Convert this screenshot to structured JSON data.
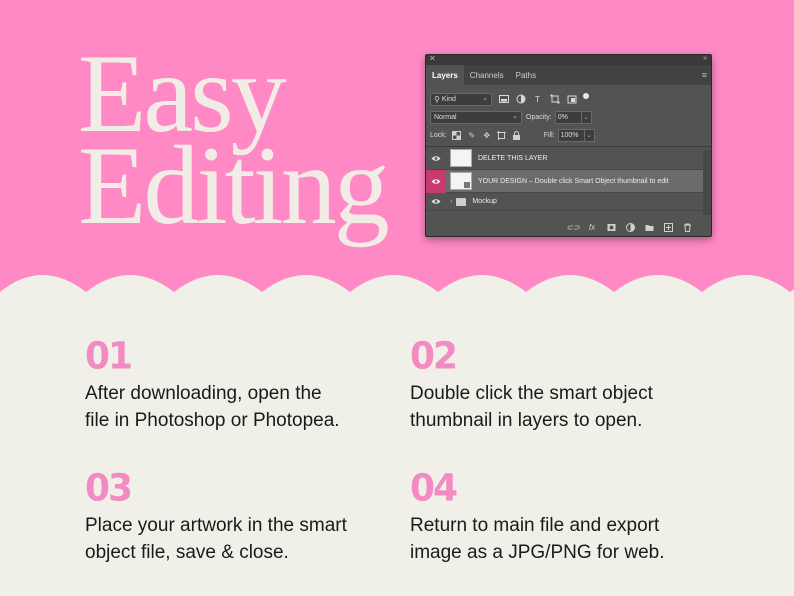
{
  "colors": {
    "hero_background": "#FF89C4",
    "cream_background": "#F1F0E8",
    "headline_text": "#F3ECE6",
    "step_number": "#F38BC3",
    "panel_background": "#535353",
    "layer_eye_highlight": "#C7396F"
  },
  "headline": {
    "line1": "Easy",
    "line2": "Editing"
  },
  "panel": {
    "tabs": [
      {
        "label": "Layers",
        "active": true
      },
      {
        "label": "Channels",
        "active": false
      },
      {
        "label": "Paths",
        "active": false
      }
    ],
    "filter_kind": "Kind",
    "filter_icons": [
      "image-filter-icon",
      "adjustment-filter-icon",
      "type-filter-icon",
      "shape-filter-icon",
      "smart-object-filter-icon"
    ],
    "blend_mode": "Normal",
    "opacity_label": "Opacity:",
    "opacity_value": "0%",
    "lock_label": "Lock:",
    "fill_label": "Fill:",
    "fill_value": "100%",
    "layers": [
      {
        "name": "DELETE THIS LAYER",
        "selected": false
      },
      {
        "name": "YOUR DESIGN – Double click Smart Object thumbnail to edit",
        "selected": true
      },
      {
        "name": "Mockup",
        "selected": false,
        "type": "group"
      }
    ],
    "bottom_icons": [
      "link-icon",
      "fx-icon",
      "mask-icon",
      "adjustment-icon",
      "folder-icon",
      "new-layer-icon",
      "trash-icon"
    ],
    "fx_label": "fx"
  },
  "steps": [
    {
      "number": "01",
      "line1": "After downloading, open the",
      "line2": "file in Photoshop or Photopea."
    },
    {
      "number": "02",
      "line1": "Double click the smart object",
      "line2": "thumbnail in layers to open."
    },
    {
      "number": "03",
      "line1": "Place your artwork in the smart",
      "line2": "object file, save & close."
    },
    {
      "number": "04",
      "line1": "Return to main file and export",
      "line2": "image as a JPG/PNG for web."
    }
  ]
}
